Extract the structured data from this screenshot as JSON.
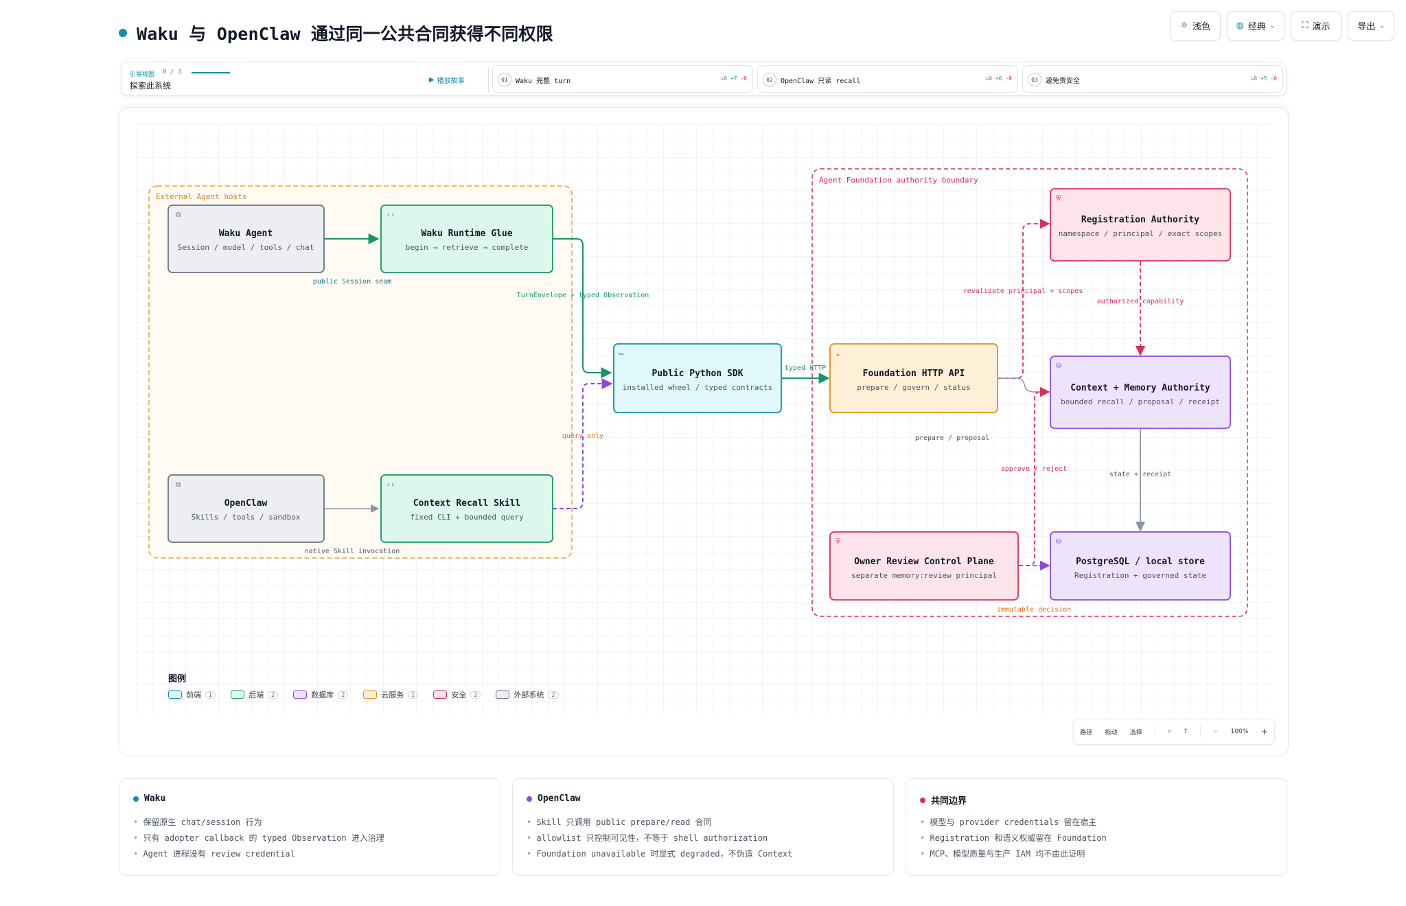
{
  "header": {
    "title": "Waku 与 OpenClaw 通过同一公共合同获得不同权限",
    "buttons": [
      {
        "icon": "sun-icon",
        "label": "浅色"
      },
      {
        "icon": "palette-icon",
        "label": "经典",
        "dropdown": true
      },
      {
        "icon": "fullscreen-icon",
        "label": "演示"
      },
      {
        "icon": "",
        "label": "导出",
        "dropdown": true
      }
    ]
  },
  "guide": {
    "label": "引导视图",
    "counter": "0 / 3",
    "subtitle": "探索此系统",
    "play_label": "播放故事",
    "steps": [
      {
        "num": "01",
        "label": "Waku 完整 turn",
        "eq": "=0",
        "plus": "+7",
        "minus": "-0"
      },
      {
        "num": "02",
        "label": "OpenClaw 只读 recall",
        "eq": "=0",
        "plus": "+6",
        "minus": "-0"
      },
      {
        "num": "03",
        "label": "避免责安全",
        "eq": "=0",
        "plus": "+5",
        "minus": "-0"
      }
    ]
  },
  "diagram": {
    "groups": {
      "external": "External Agent hosts",
      "foundation": "Agent Foundation authority boundary"
    },
    "nodes": {
      "waku_agent": {
        "title": "Waku Agent",
        "sub": "Session / model / tools / chat"
      },
      "waku_glue": {
        "title": "Waku Runtime Glue",
        "sub": "begin → retrieve → complete"
      },
      "openclaw": {
        "title": "OpenClaw",
        "sub": "Skills / tools / sandbox"
      },
      "recall_skill": {
        "title": "Context Recall Skill",
        "sub": "fixed CLI + bounded query"
      },
      "sdk": {
        "title": "Public Python SDK",
        "sub": "installed wheel / typed contracts"
      },
      "http_api": {
        "title": "Foundation HTTP API",
        "sub": "prepare / govern / status"
      },
      "registration": {
        "title": "Registration Authority",
        "sub": "namespace / principal / exact scopes"
      },
      "context_memory": {
        "title": "Context + Memory Authority",
        "sub": "bounded recall / proposal / receipt"
      },
      "owner_review": {
        "title": "Owner Review Control Plane",
        "sub": "separate memory:review principal"
      },
      "postgres": {
        "title": "PostgreSQL / local store",
        "sub": "Registration + governed state"
      }
    },
    "edges": {
      "public_session": "public Session seam",
      "turn_envelope": "TurnEnvelope + typed Observation",
      "native_skill": "native Skill invocation",
      "query_only": "query only",
      "typed_http": "typed HTTP",
      "revalidate": "revalidate principal + scopes",
      "authorized": "authorized capability",
      "prepare_proposal": "prepare / proposal",
      "approve_reject": "approve / reject",
      "state_receipt": "state + receipt",
      "immutable": "immutable decision"
    }
  },
  "legend": {
    "title": "图例",
    "items": [
      {
        "label": "前端",
        "count": "1",
        "color": "#0e8fa8",
        "fill": "#e0f7fb"
      },
      {
        "label": "后端",
        "count": "2",
        "color": "#16946a",
        "fill": "#dcf7ec"
      },
      {
        "label": "数据库",
        "count": "2",
        "color": "#8b47e0",
        "fill": "#ede4fc"
      },
      {
        "label": "云服务",
        "count": "1",
        "color": "#dd9211",
        "fill": "#fdf0d6"
      },
      {
        "label": "安全",
        "count": "2",
        "color": "#d92f57",
        "fill": "#fde4ea"
      },
      {
        "label": "外部系统",
        "count": "2",
        "color": "#6b7280",
        "fill": "#eceef2"
      }
    ]
  },
  "toolbar": {
    "items": [
      "路径",
      "拖动",
      "选择"
    ],
    "zoom": "100%"
  },
  "info_cards": [
    {
      "title": "Waku",
      "color": "#0e8fa8",
      "lines": [
        "保留原生 chat/session 行为",
        "只有 adopter callback 的 typed Observation 进入治理",
        "Agent 进程没有 review credential"
      ]
    },
    {
      "title": "OpenClaw",
      "color": "#8b47e0",
      "lines": [
        "Skill 只调用 public prepare/read 合同",
        "allowlist 只控制可见性，不等于 shell authorization",
        "Foundation unavailable 时显式 degraded，不伪造 Context"
      ]
    },
    {
      "title": "共同边界",
      "color": "#d92f57",
      "lines": [
        "模型与 provider credentials 留在宿主",
        "Registration 和语义权威留在 Foundation",
        "MCP、模型质量与生产 IAM 均不由此证明"
      ]
    }
  ]
}
